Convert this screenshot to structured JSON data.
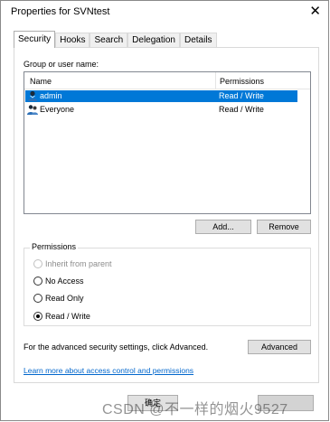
{
  "window": {
    "title": "Properties for SVNtest",
    "close_glyph": "✕"
  },
  "tabs": [
    {
      "label": "Security",
      "active": true
    },
    {
      "label": "Hooks"
    },
    {
      "label": "Search"
    },
    {
      "label": "Delegation"
    },
    {
      "label": "Details"
    }
  ],
  "security": {
    "group_label": "Group or user name:",
    "columns": {
      "name": "Name",
      "permissions": "Permissions"
    },
    "rows": [
      {
        "name": "admin",
        "permission": "Read / Write",
        "selected": true,
        "icon": "user-icon"
      },
      {
        "name": "Everyone",
        "permission": "Read / Write",
        "selected": false,
        "icon": "group-icon"
      }
    ],
    "add_label": "Add...",
    "remove_label": "Remove",
    "permissions_group_title": "Permissions",
    "options": [
      {
        "label": "Inherit from parent",
        "disabled": true,
        "checked": false
      },
      {
        "label": "No Access",
        "checked": false
      },
      {
        "label": "Read Only",
        "checked": false
      },
      {
        "label": "Read / Write",
        "checked": true
      }
    ],
    "advanced_text": "For the advanced security settings, click Advanced.",
    "advanced_label": "Advanced",
    "learn_more": "Learn more about access control and permissions"
  },
  "footer": {
    "ok_label": "确定"
  },
  "watermark": "CSDN @不一样的烟火9527",
  "colors": {
    "selection": "#0078d7",
    "link": "#0066cc"
  }
}
